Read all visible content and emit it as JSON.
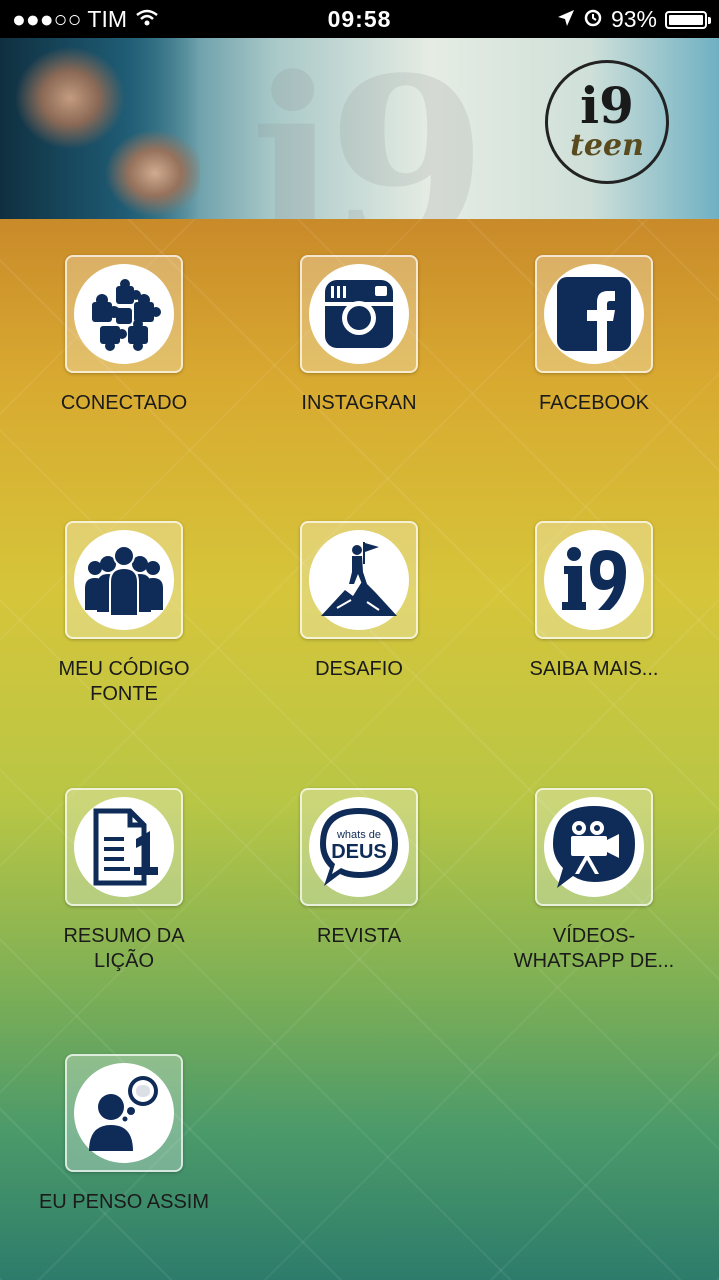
{
  "status_bar": {
    "carrier": "●●●○○ TIM",
    "time": "09:58",
    "battery": "93%"
  },
  "banner": {
    "watermark": "i9",
    "logo_top": "i9",
    "logo_bottom": "teen"
  },
  "tiles": [
    {
      "label": "CONECTADO",
      "icon": "puzzle-icon"
    },
    {
      "label": "INSTAGRAN",
      "icon": "instagram-icon"
    },
    {
      "label": "FACEBOOK",
      "icon": "facebook-icon"
    },
    {
      "label": "MEU CÓDIGO FONTE",
      "icon": "group-icon"
    },
    {
      "label": "DESAFIO",
      "icon": "mountain-flag-icon"
    },
    {
      "label": "SAIBA MAIS...",
      "icon": "i9-icon"
    },
    {
      "label": "RESUMO DA LIÇÃO",
      "icon": "document-icon"
    },
    {
      "label": "REVISTA",
      "icon": "whats-de-deus-icon",
      "icon_text_top": "whats de",
      "icon_text_bottom": "DEUS"
    },
    {
      "label": "VÍDEOS-WHATSAPP DE...",
      "icon": "video-camera-icon"
    },
    {
      "label": "EU PENSO ASSIM",
      "icon": "thinking-person-icon"
    }
  ],
  "colors": {
    "icon": "#0f2b57",
    "label": "#1b1b1b"
  }
}
